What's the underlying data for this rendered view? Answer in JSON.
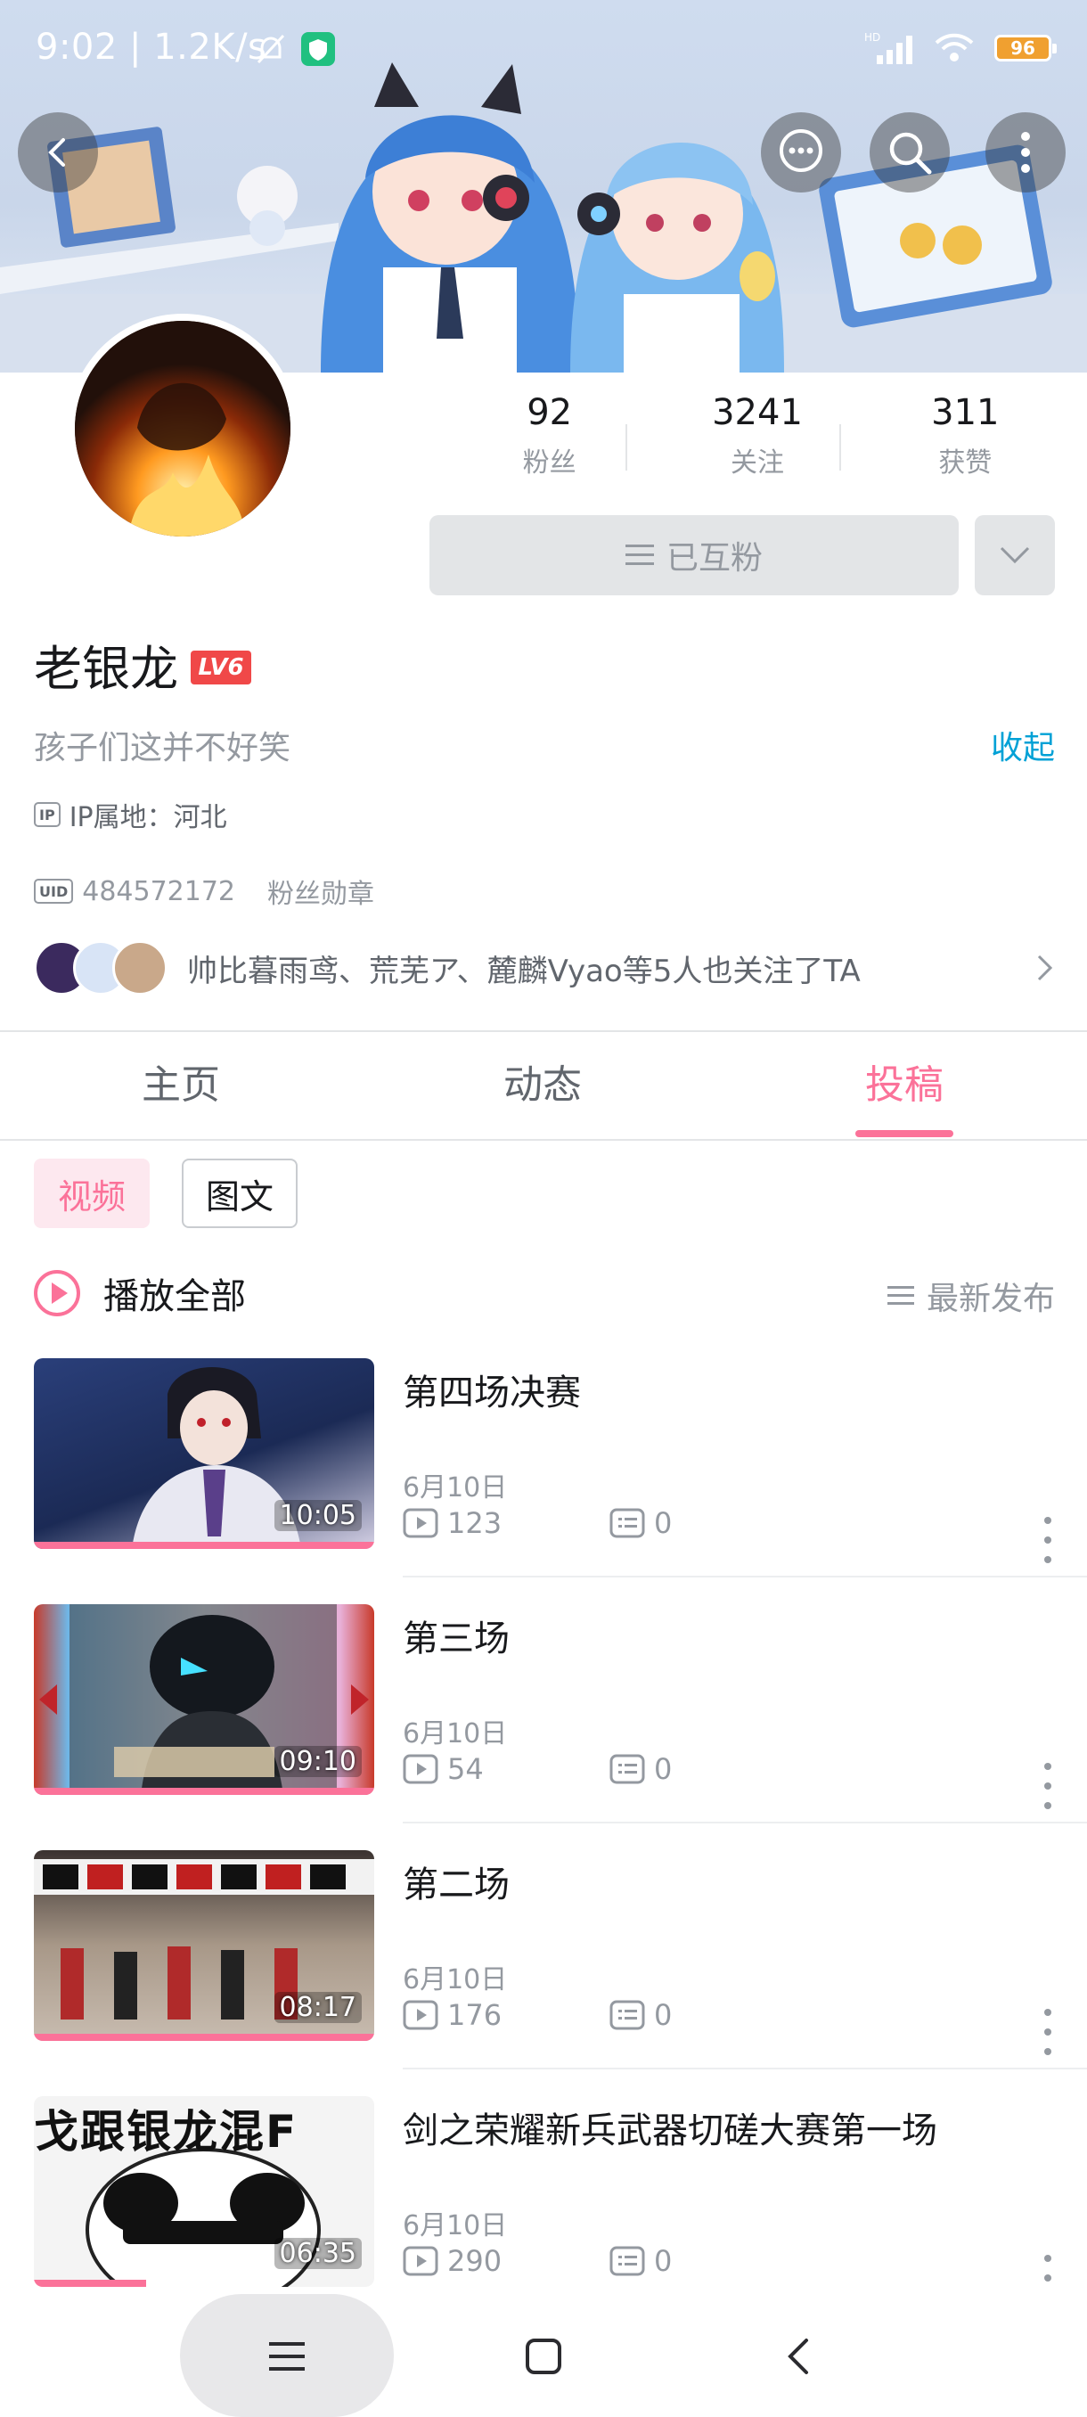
{
  "status_bar": {
    "time": "9:02 | 1.2K/s",
    "battery": "96"
  },
  "profile": {
    "stats": [
      {
        "value": "92",
        "label": "粉丝"
      },
      {
        "value": "3241",
        "label": "关注"
      },
      {
        "value": "311",
        "label": "获赞"
      }
    ],
    "follow_button": "已互粉",
    "username": "老银龙",
    "level_badge": "LV6",
    "bio": "孩子们这并不好笑",
    "collapse_label": "收起",
    "ip_icon": "IP",
    "ip_location": "IP属地：河北",
    "uid_icon": "UID",
    "uid": "484572172",
    "fan_medal": "粉丝勋章",
    "mutual_follow_text": "帅比暮雨鸢、荒芜ア、麓麟Vyao等5人也关注了TA"
  },
  "tabs": [
    {
      "label": "主页",
      "active": false
    },
    {
      "label": "动态",
      "active": false
    },
    {
      "label": "投稿",
      "active": true
    }
  ],
  "filter_chips": {
    "video": "视频",
    "article": "图文"
  },
  "list_header": {
    "play_all": "播放全部",
    "sort": "最新发布"
  },
  "videos": [
    {
      "title": "第四场决赛",
      "duration": "10:05",
      "date": "6月10日",
      "plays": "123",
      "comments": "0",
      "watched": 1.0
    },
    {
      "title": "第三场",
      "duration": "09:10",
      "date": "6月10日",
      "plays": "54",
      "comments": "0",
      "watched": 1.0
    },
    {
      "title": "第二场",
      "duration": "08:17",
      "date": "6月10日",
      "plays": "176",
      "comments": "0",
      "watched": 1.0
    },
    {
      "title": "剑之荣耀新兵武器切磋大赛第一场",
      "duration": "06:35",
      "date": "6月10日",
      "plays": "290",
      "comments": "0",
      "watched": 0.33
    }
  ],
  "thumb4_caption": "戈跟银龙混F",
  "colors": {
    "accent": "#fb7299",
    "link": "#00a1d6",
    "muted": "#9499a0"
  }
}
